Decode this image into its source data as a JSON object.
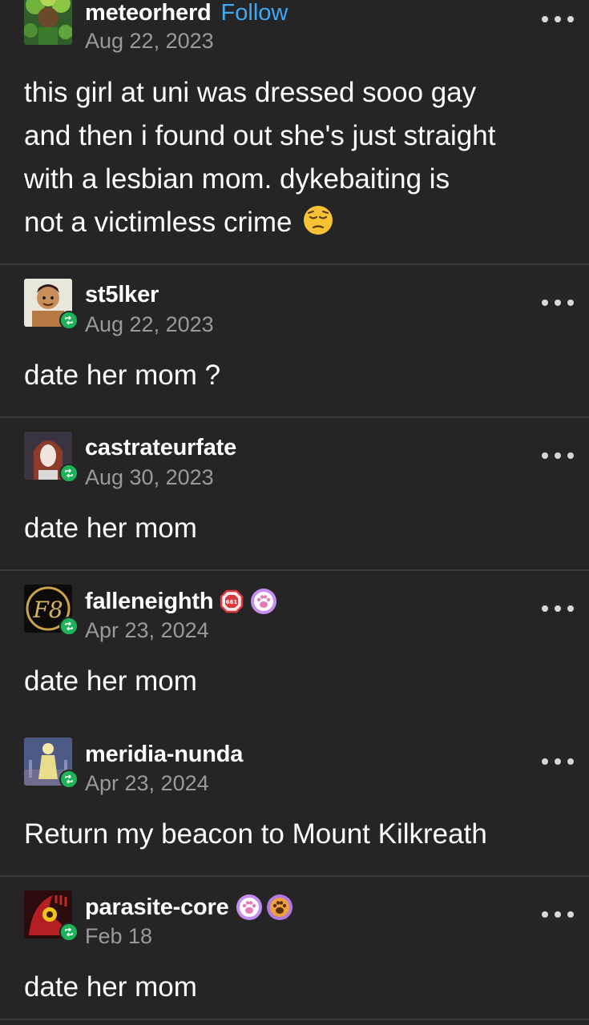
{
  "posts": [
    {
      "username": "meteorherd",
      "follow_label": "Follow",
      "date": "Aug 22, 2023",
      "body_lines": [
        "this girl at uni was dressed sooo gay",
        "and then i found out she's just straight",
        "with a lesbian mom. dykebaiting is",
        "not a victimless crime"
      ],
      "emoji": "pensive-face",
      "avatar": "green-foliage-character-avatar"
    },
    {
      "username": "st5lker",
      "date": "Aug 22, 2023",
      "body": "date her mom ?",
      "avatar": "cartoon-character-avatar",
      "reblog_icon": "reblog-icon"
    },
    {
      "username": "castrateurfate",
      "date": "Aug 30, 2023",
      "body": "date her mom",
      "avatar": "red-haired-character-avatar",
      "reblog_icon": "reblog-icon"
    },
    {
      "username": "falleneighth",
      "date": "Apr 23, 2024",
      "body": "date her mom",
      "avatar": "gold-monogram-avatar",
      "avatar_text": "F8",
      "badges": [
        {
          "icon": "red-octagon-badge-icon",
          "text": "661",
          "color": "#d9363e"
        },
        {
          "icon": "paw-print-badge-icon",
          "color": "#c58df0"
        }
      ],
      "reblog_icon": "reblog-icon"
    },
    {
      "username": "meridia-nunda",
      "date": "Apr 23, 2024",
      "body": "Return my beacon to Mount Kilkreath",
      "avatar": "glowing-statue-avatar",
      "reblog_icon": "reblog-icon"
    },
    {
      "username": "parasite-core",
      "date": "Feb 18",
      "body": "date her mom",
      "avatar": "red-yellow-creature-avatar",
      "badges": [
        {
          "icon": "paw-print-badge-icon",
          "color": "#c58df0"
        },
        {
          "icon": "orange-paw-badge-icon",
          "color": "#e8902e"
        }
      ],
      "reblog_icon": "reblog-icon"
    }
  ],
  "colors": {
    "background": "#252526",
    "divider": "#3a3a3c",
    "follow": "#3fa9f5",
    "date": "#9a9a9a",
    "reblog_badge": "#1eb35a"
  },
  "more_icon": "more-options-icon"
}
